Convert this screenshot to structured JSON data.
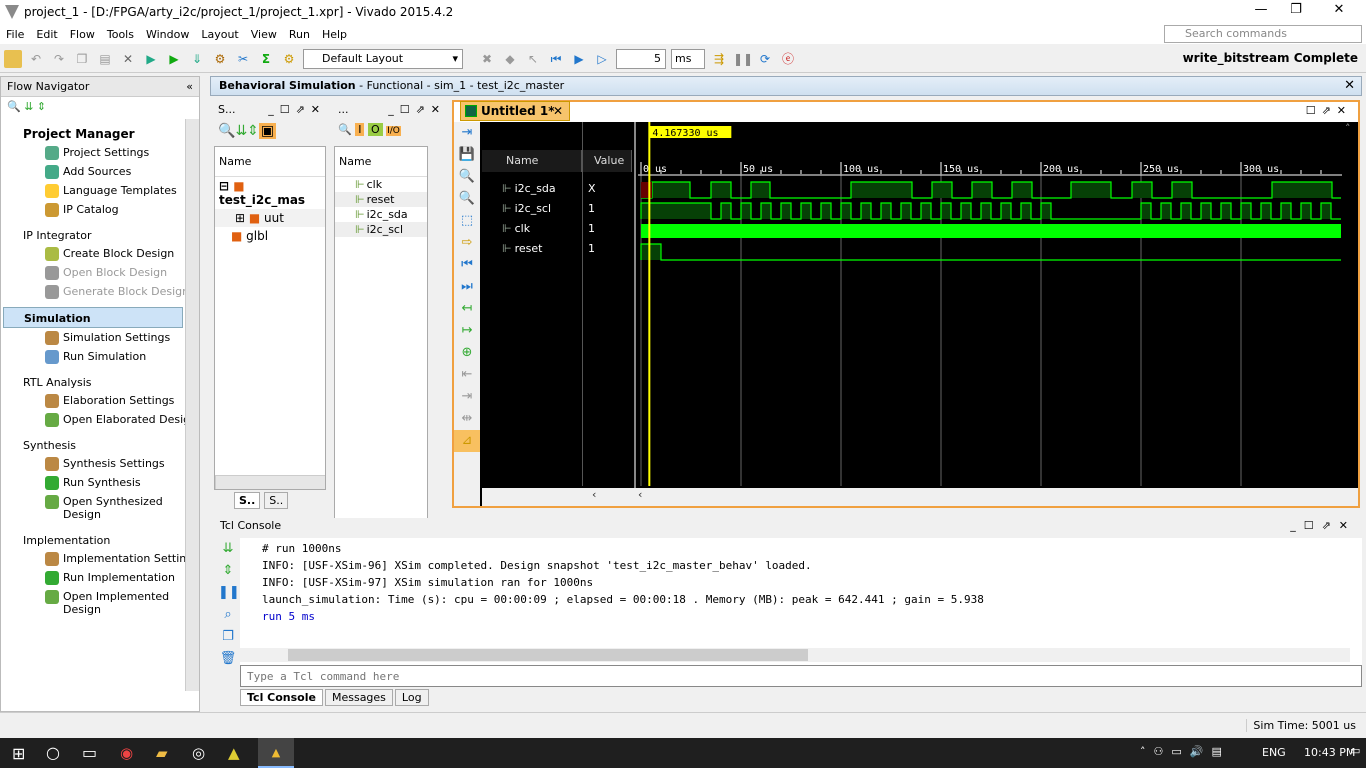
{
  "window": {
    "title": "project_1 - [D:/FPGA/arty_i2c/project_1/project_1.xpr] - Vivado 2015.4.2",
    "min": "—",
    "max": "❐",
    "close": "✕"
  },
  "menu": [
    "File",
    "Edit",
    "Flow",
    "Tools",
    "Window",
    "Layout",
    "View",
    "Run",
    "Help"
  ],
  "search_placeholder": "Search commands",
  "toolbar": {
    "layout": "Default Layout",
    "run_time": "5",
    "run_unit": "ms",
    "status": "write_bitstream Complete"
  },
  "flow_navigator": {
    "title": "Flow Navigator",
    "sections": [
      {
        "label": "Project Manager",
        "bold": true,
        "items": [
          {
            "label": "Project Settings"
          },
          {
            "label": "Add Sources"
          },
          {
            "label": "Language Templates"
          },
          {
            "label": "IP Catalog"
          }
        ]
      },
      {
        "label": "IP Integrator",
        "items": [
          {
            "label": "Create Block Design"
          },
          {
            "label": "Open Block Design",
            "disabled": true
          },
          {
            "label": "Generate Block Design",
            "disabled": true
          }
        ]
      },
      {
        "label": "Simulation",
        "selected": true,
        "items": [
          {
            "label": "Simulation Settings"
          },
          {
            "label": "Run Simulation"
          }
        ]
      },
      {
        "label": "RTL Analysis",
        "items": [
          {
            "label": "Elaboration Settings"
          },
          {
            "label": "Open Elaborated Design"
          }
        ]
      },
      {
        "label": "Synthesis",
        "items": [
          {
            "label": "Synthesis Settings"
          },
          {
            "label": "Run Synthesis"
          },
          {
            "label": "Open Synthesized Design"
          }
        ]
      },
      {
        "label": "Implementation",
        "items": [
          {
            "label": "Implementation Settings"
          },
          {
            "label": "Run Implementation"
          },
          {
            "label": "Open Implemented Design"
          }
        ]
      }
    ]
  },
  "sim_header": {
    "bold": "Behavioral Simulation",
    "rest": " - Functional - sim_1 - test_i2c_master"
  },
  "scopes": {
    "title": "S...",
    "col": "Name",
    "tree": [
      "test_i2c_mas",
      "uut",
      "glbl"
    ],
    "tabs": [
      "S..",
      "S.."
    ]
  },
  "objects": {
    "title": "...",
    "col": "Name",
    "items": [
      "clk",
      "reset",
      "i2c_sda",
      "i2c_scl"
    ]
  },
  "wave": {
    "tab": "Untitled 1*",
    "cursor": "4.167330 us",
    "cursor_time_us": 4.16733,
    "col_name": "Name",
    "col_value": "Value",
    "signals": [
      {
        "name": "i2c_sda",
        "value": "X"
      },
      {
        "name": "i2c_scl",
        "value": "1"
      },
      {
        "name": "clk",
        "value": "1"
      },
      {
        "name": "reset",
        "value": "1"
      }
    ],
    "ticks": [
      "0 us",
      "50 us",
      "100 us",
      "150 us",
      "200 us",
      "250 us",
      "300 us"
    ],
    "view_range_us": [
      0,
      350
    ],
    "sda_high_us": [
      [
        5.5,
        24.5
      ],
      [
        35,
        45
      ],
      [
        55,
        64.5
      ],
      [
        105,
        135.5
      ],
      [
        145.5,
        155.5
      ],
      [
        165.5,
        175.5
      ],
      [
        185.5,
        195.5
      ],
      [
        215,
        235
      ],
      [
        245.5,
        255.5
      ],
      [
        265.5,
        275.5
      ],
      [
        315.5,
        345.5
      ]
    ],
    "reset_high_us": [
      0,
      10
    ],
    "wave_color": "#00ff00"
  },
  "console": {
    "title": "Tcl Console",
    "lines": [
      "# run 1000ns",
      "INFO: [USF-XSim-96] XSim completed. Design snapshot 'test_i2c_master_behav' loaded.",
      "INFO: [USF-XSim-97] XSim simulation ran for 1000ns",
      "launch_simulation: Time (s): cpu = 00:00:09 ; elapsed = 00:00:18 . Memory (MB): peak = 642.441 ; gain = 5.938"
    ],
    "command": "run 5 ms",
    "placeholder": "Type a Tcl command here",
    "tabs": [
      "Tcl Console",
      "Messages",
      "Log"
    ]
  },
  "statusbar": {
    "sim_time": "Sim Time: 5001 us"
  },
  "taskbar": {
    "lang": "ENG",
    "time": "10:43 PM"
  }
}
